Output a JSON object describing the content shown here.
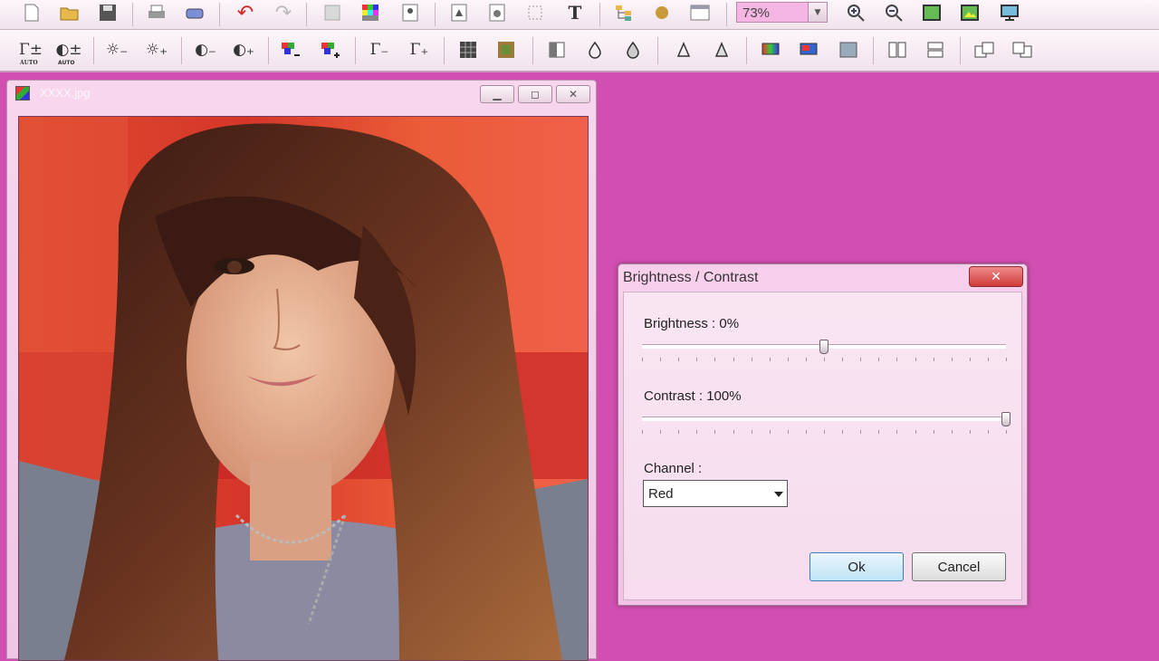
{
  "toolbar": {
    "zoom_value": "73%"
  },
  "image_window": {
    "title": "XXXX.jpg"
  },
  "dialog": {
    "title": "Brightness / Contrast",
    "close_glyph": "✕",
    "brightness_label": "Brightness : 0%",
    "brightness_value": 0,
    "contrast_label": "Contrast : 100%",
    "contrast_value": 100,
    "channel_label": "Channel :",
    "channel_selected": "Red",
    "ok_label": "Ok",
    "cancel_label": "Cancel"
  }
}
